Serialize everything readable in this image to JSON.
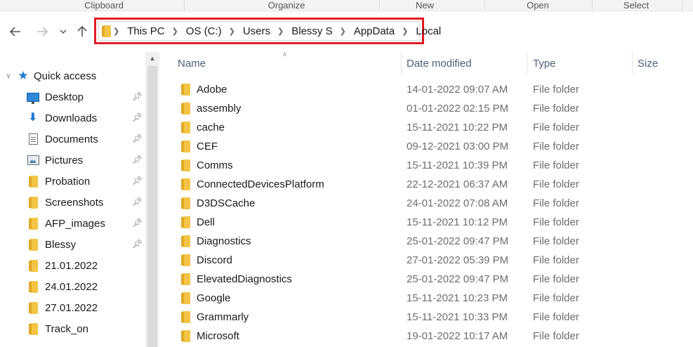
{
  "ribbon": {
    "groups": [
      "Clipboard",
      "Organize",
      "New",
      "Open",
      "Select"
    ]
  },
  "navigation": {
    "back_icon": "arrow-left-icon",
    "forward_icon": "arrow-right-icon",
    "recent_icon": "chevron-down-icon",
    "up_icon": "arrow-up-icon"
  },
  "address_bar": {
    "highlight_color": "#e01b24",
    "crumbs": [
      "This PC",
      "OS (C:)",
      "Users",
      "Blessy S",
      "AppData",
      "Local"
    ]
  },
  "sidebar": {
    "quick_access_label": "Quick access",
    "items": [
      {
        "label": "Desktop",
        "icon": "desktop-icon",
        "pinned": true
      },
      {
        "label": "Downloads",
        "icon": "download-icon",
        "pinned": true
      },
      {
        "label": "Documents",
        "icon": "documents-icon",
        "pinned": true
      },
      {
        "label": "Pictures",
        "icon": "pictures-icon",
        "pinned": true
      },
      {
        "label": "Probation",
        "icon": "folder-icon",
        "pinned": true
      },
      {
        "label": "Screenshots",
        "icon": "folder-icon",
        "pinned": true
      },
      {
        "label": "AFP_images",
        "icon": "folder-icon",
        "pinned": true
      },
      {
        "label": "Blessy",
        "icon": "folder-icon",
        "pinned": true
      },
      {
        "label": "21.01.2022",
        "icon": "folder-icon",
        "pinned": false
      },
      {
        "label": "24.01.2022",
        "icon": "folder-icon",
        "pinned": false
      },
      {
        "label": "27.01.2022",
        "icon": "folder-icon",
        "pinned": false
      },
      {
        "label": "Track_on",
        "icon": "folder-icon",
        "pinned": false
      }
    ]
  },
  "file_list": {
    "columns": {
      "name": "Name",
      "date": "Date modified",
      "type": "Type",
      "size": "Size"
    },
    "rows": [
      {
        "name": "Adobe",
        "date": "14-01-2022 09:07 AM",
        "type": "File folder"
      },
      {
        "name": "assembly",
        "date": "01-01-2022 02:15 PM",
        "type": "File folder"
      },
      {
        "name": "cache",
        "date": "15-11-2021 10:22 PM",
        "type": "File folder"
      },
      {
        "name": "CEF",
        "date": "09-12-2021 03:00 PM",
        "type": "File folder"
      },
      {
        "name": "Comms",
        "date": "15-11-2021 10:39 PM",
        "type": "File folder"
      },
      {
        "name": "ConnectedDevicesPlatform",
        "date": "22-12-2021 06:37 AM",
        "type": "File folder"
      },
      {
        "name": "D3DSCache",
        "date": "24-01-2022 07:08 AM",
        "type": "File folder"
      },
      {
        "name": "Dell",
        "date": "15-11-2021 10:12 PM",
        "type": "File folder"
      },
      {
        "name": "Diagnostics",
        "date": "25-01-2022 09:47 PM",
        "type": "File folder"
      },
      {
        "name": "Discord",
        "date": "27-01-2022 05:39 PM",
        "type": "File folder"
      },
      {
        "name": "ElevatedDiagnostics",
        "date": "25-01-2022 09:47 PM",
        "type": "File folder"
      },
      {
        "name": "Google",
        "date": "15-11-2021 10:23 PM",
        "type": "File folder"
      },
      {
        "name": "Grammarly",
        "date": "15-11-2021 10:33 PM",
        "type": "File folder"
      },
      {
        "name": "Microsoft",
        "date": "19-01-2022 10:17 AM",
        "type": "File folder"
      }
    ]
  }
}
